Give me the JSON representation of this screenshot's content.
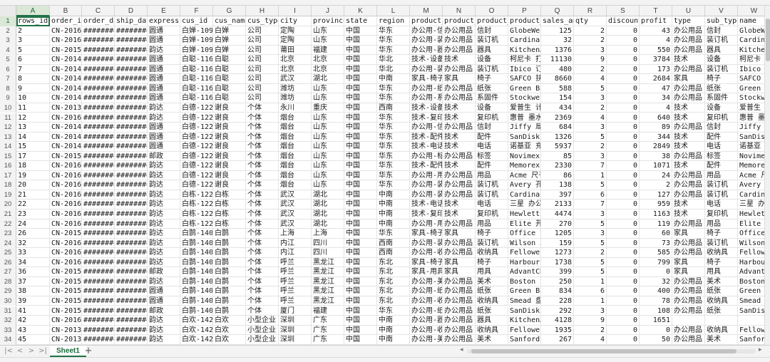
{
  "columns": [
    "A",
    "B",
    "C",
    "D",
    "E",
    "F",
    "G",
    "H",
    "I",
    "J",
    "K",
    "L",
    "M",
    "N",
    "O",
    "P",
    "Q",
    "R",
    "S",
    "T",
    "U",
    "V",
    "W"
  ],
  "selected_column": "A",
  "active_cell": "A1",
  "sheet_tab": "Sheet1",
  "add_sheet": "+",
  "nav": [
    "|<",
    "<",
    ">",
    ">|"
  ],
  "rows": [
    {
      "n": "1",
      "c": [
        "rows_id",
        "order_id",
        "order_dat",
        "ship_date",
        "express",
        "cus_id",
        "cus_name",
        "cus_type",
        "city",
        "province",
        "state",
        "region",
        "product_i",
        "product_t",
        "product_t",
        "product_n",
        "sales_amt",
        "qty",
        "discount",
        "profit",
        "type",
        "sub_type",
        "name"
      ]
    },
    {
      "n": "2",
      "c": [
        "2",
        "CN-2016-1",
        "#########",
        "#########",
        "圆通",
        "白婵-1097",
        "白婵",
        "公司",
        "定陶",
        "山东",
        "中国",
        "华东",
        "办公用-信",
        "办公用品",
        "信封",
        "GlobeWeis",
        "125",
        "2",
        "0",
        "43",
        "办公用品",
        "信封",
        "GlobeWeis"
      ]
    },
    {
      "n": "3",
      "c": [
        "3",
        "CN-2016-1",
        "#########",
        "#########",
        "圆通",
        "白婵-1097",
        "白婵",
        "公司",
        "定陶",
        "山东",
        "中国",
        "华东",
        "办公用-装",
        "办公用品",
        "装订机",
        "Cardinal",
        "32",
        "2",
        "0",
        "4",
        "办公用品",
        "装订机",
        "Cardinal"
      ]
    },
    {
      "n": "4",
      "c": [
        "5",
        "CN-2015-1",
        "#########",
        "#########",
        "韵达",
        "白婵-1097",
        "白婵",
        "公司",
        "莆田",
        "福建",
        "中国",
        "华东",
        "办公用-器",
        "办公用品",
        "器具",
        "KitchenAi",
        "1376",
        "3",
        "0",
        "550",
        "办公用品",
        "器具",
        "KitchenAi"
      ]
    },
    {
      "n": "5",
      "c": [
        "6",
        "CN-2014-4",
        "#########",
        "#########",
        "圆通",
        "白聪-1160",
        "白聪",
        "公司",
        "北京",
        "北京",
        "中国",
        "华北",
        "技术-设备",
        "技术",
        "设备",
        "柯尼卡 打",
        "11130",
        "9",
        "0",
        "3784",
        "技术",
        "设备",
        "柯尼卡 打"
      ]
    },
    {
      "n": "6",
      "c": [
        "7",
        "CN-2014-4",
        "#########",
        "#########",
        "圆通",
        "白聪-1160",
        "白聪",
        "公司",
        "北京",
        "北京",
        "中国",
        "华北",
        "办公用-装",
        "办公用品",
        "装订机",
        "Ibico 订",
        "480",
        "2",
        "0",
        "173",
        "办公用品",
        "装订机",
        "Ibico 订"
      ]
    },
    {
      "n": "7",
      "c": [
        "8",
        "CN-2014-4",
        "#########",
        "#########",
        "圆通",
        "白聪-1160",
        "白聪",
        "公司",
        "武汉",
        "湖北",
        "中国",
        "中南",
        "家具-椅子",
        "家具",
        "椅子",
        "SAFCO 扶",
        "8660",
        "4",
        "0",
        "2684",
        "家具",
        "椅子",
        "SAFCO 扶"
      ]
    },
    {
      "n": "8",
      "c": [
        "9",
        "CN-2014-4",
        "#########",
        "#########",
        "圆通",
        "白聪-1160",
        "白聪",
        "公司",
        "潍坊",
        "山东",
        "中国",
        "华东",
        "办公用-纸",
        "办公用品",
        "纸张",
        "Green Bar",
        "588",
        "5",
        "0",
        "47",
        "办公用品",
        "纸张",
        "Green Bar"
      ]
    },
    {
      "n": "9",
      "c": [
        "10",
        "CN-2014-4",
        "#########",
        "#########",
        "圆通",
        "白聪-1160",
        "白聪",
        "公司",
        "潍坊",
        "山东",
        "中国",
        "华东",
        "办公用-系",
        "办公用品",
        "系固件",
        "Stockwell",
        "154",
        "3",
        "0",
        "34",
        "办公用品",
        "系固件",
        "Stockwell"
      ]
    },
    {
      "n": "10",
      "c": [
        "11",
        "CN-2013-4",
        "#########",
        "#########",
        "韵达",
        "白德-1220",
        "谢良",
        "个体",
        "永川",
        "重庆",
        "中国",
        "西南",
        "技术-设备",
        "技术",
        "设备",
        "爱普生 计",
        "434",
        "2",
        "0",
        "4",
        "技术",
        "设备",
        "爱普生 计"
      ]
    },
    {
      "n": "11",
      "c": [
        "12",
        "CN-2016-1",
        "#########",
        "#########",
        "韵达",
        "白德-1220",
        "谢良",
        "个体",
        "烟台",
        "山东",
        "中国",
        "华东",
        "技术-复印",
        "技术",
        "复印机",
        "惠普 墨水",
        "2369",
        "4",
        "0",
        "640",
        "技术",
        "复印机",
        "惠普 墨水"
      ]
    },
    {
      "n": "12",
      "c": [
        "13",
        "CN-2014-1",
        "#########",
        "#########",
        "圆通",
        "白德-1220",
        "谢良",
        "个体",
        "烟台",
        "山东",
        "中国",
        "华东",
        "办公用-信",
        "办公用品",
        "信封",
        "Jiffy 局",
        "684",
        "3",
        "0",
        "89",
        "办公用品",
        "信封",
        "Jiffy 局"
      ]
    },
    {
      "n": "13",
      "c": [
        "14",
        "CN-2014-1",
        "#########",
        "#########",
        "圆通",
        "白德-1220",
        "谢良",
        "个体",
        "烟台",
        "山东",
        "中国",
        "华东",
        "技术-配件",
        "技术",
        "配件",
        "SanDisk 键",
        "1326",
        "5",
        "0",
        "344",
        "技术",
        "配件",
        "SanDisk 键"
      ]
    },
    {
      "n": "14",
      "c": [
        "15",
        "CN-2014-1",
        "#########",
        "#########",
        "圆通",
        "白德-1220",
        "谢良",
        "个体",
        "烟台",
        "山东",
        "中国",
        "华东",
        "技术-电话",
        "技术",
        "电话",
        "诺基亚 充",
        "5937",
        "2",
        "0",
        "2849",
        "技术",
        "电话",
        "诺基亚 充"
      ]
    },
    {
      "n": "15",
      "c": [
        "17",
        "CN-2015-1",
        "#########",
        "#########",
        "邮政",
        "白德-1220",
        "谢良",
        "个体",
        "烟台",
        "山东",
        "中国",
        "华东",
        "办公用-标",
        "办公用品",
        "标签",
        "Novimex 圆",
        "85",
        "3",
        "0",
        "38",
        "办公用品",
        "标签",
        "Novimex 圆"
      ]
    },
    {
      "n": "16",
      "c": [
        "18",
        "CN-2016-1",
        "#########",
        "#########",
        "韵达",
        "白德-1220",
        "谢良",
        "个体",
        "烟台",
        "山东",
        "中国",
        "华东",
        "技术-配件",
        "技术",
        "配件",
        "Memorex 键",
        "2330",
        "7",
        "0",
        "1071",
        "技术",
        "配件",
        "Memorex 键"
      ]
    },
    {
      "n": "17",
      "c": [
        "19",
        "CN-2016-1",
        "#########",
        "#########",
        "韵达",
        "白德-1220",
        "谢良",
        "个体",
        "烟台",
        "山东",
        "中国",
        "华东",
        "办公用-用",
        "办公用品",
        "用品",
        "Acme 尺子",
        "86",
        "1",
        "0",
        "24",
        "办公用品",
        "用品",
        "Acme 尺子"
      ]
    },
    {
      "n": "18",
      "c": [
        "20",
        "CN-2016-1",
        "#########",
        "#########",
        "韵达",
        "白德-1220",
        "谢良",
        "个体",
        "烟台",
        "山东",
        "中国",
        "华东",
        "办公用-装",
        "办公用品",
        "装订机",
        "Avery 孔加",
        "138",
        "5",
        "0",
        "2",
        "办公用品",
        "装订机",
        "Avery 孔加"
      ]
    },
    {
      "n": "19",
      "c": [
        "21",
        "CN-2016-1",
        "#########",
        "#########",
        "韵达",
        "白栋-1225",
        "白栋",
        "个体",
        "武汉",
        "湖北",
        "中国",
        "中南",
        "办公用-装",
        "办公用品",
        "装订机",
        "Cardinal",
        "397",
        "6",
        "0",
        "127",
        "办公用品",
        "装订机",
        "Cardinal"
      ]
    },
    {
      "n": "20",
      "c": [
        "22",
        "CN-2016-1",
        "#########",
        "#########",
        "韵达",
        "白栋-1225",
        "白栋",
        "个体",
        "武汉",
        "湖北",
        "中国",
        "中南",
        "技术-电话",
        "技术",
        "电话",
        "三星 办公",
        "2133",
        "7",
        "0",
        "959",
        "技术",
        "电话",
        "三星 办公"
      ]
    },
    {
      "n": "21",
      "c": [
        "23",
        "CN-2016-1",
        "#########",
        "#########",
        "韵达",
        "白栋-1225",
        "白栋",
        "个体",
        "武汉",
        "湖北",
        "中国",
        "中南",
        "技术-复印",
        "技术",
        "复印机",
        "Hewlett 复",
        "4474",
        "3",
        "0",
        "1163",
        "技术",
        "复印机",
        "Hewlett 复"
      ]
    },
    {
      "n": "22",
      "c": [
        "24",
        "CN-2016-1",
        "#########",
        "#########",
        "韵达",
        "白栋-1225",
        "白栋",
        "个体",
        "武汉",
        "湖北",
        "中国",
        "中南",
        "办公用-用",
        "办公用品",
        "用品",
        "Elite 开信",
        "270",
        "5",
        "0",
        "119",
        "办公用品",
        "用品",
        "Elite 开信"
      ]
    },
    {
      "n": "23",
      "c": [
        "26",
        "CN-2015-4",
        "#########",
        "#########",
        "韵达",
        "白鹊-1400",
        "白鹊",
        "个体",
        "上海",
        "上海",
        "中国",
        "华东",
        "家具-椅子",
        "家具",
        "椅子",
        "Office St",
        "1205",
        "3",
        "0",
        "60",
        "家具",
        "椅子",
        "Office St"
      ]
    },
    {
      "n": "24",
      "c": [
        "32",
        "CN-2016-1",
        "#########",
        "#########",
        "韵达",
        "白鹊-1400",
        "白鹊",
        "个体",
        "内江",
        "四川",
        "中国",
        "西南",
        "办公用-装",
        "办公用品",
        "装订机",
        "Wilson Jo",
        "159",
        "5",
        "0",
        "73",
        "办公用品",
        "装订机",
        "Wilson Jo"
      ]
    },
    {
      "n": "25",
      "c": [
        "33",
        "CN-2016-1",
        "#########",
        "#########",
        "韵达",
        "白鹊-1400",
        "白鹊",
        "个体",
        "内江",
        "四川",
        "中国",
        "西南",
        "办公用-收",
        "办公用品",
        "收纳具",
        "Fellowes",
        "1273",
        "2",
        "0",
        "585",
        "办公用品",
        "收纳具",
        "Fellowes"
      ]
    },
    {
      "n": "26",
      "c": [
        "34",
        "CN-2016-1",
        "#########",
        "#########",
        "韵达",
        "白鹊-1400",
        "白鹊",
        "个体",
        "呼兰",
        "黑龙江",
        "中国",
        "东北",
        "家具-椅子",
        "家具",
        "椅子",
        "Harbour 扶",
        "1738",
        "5",
        "0",
        "799",
        "家具",
        "椅子",
        "Harbour 扶"
      ]
    },
    {
      "n": "27",
      "c": [
        "36",
        "CN-2015-1",
        "#########",
        "#########",
        "邮政",
        "白鹊-1400",
        "白鹊",
        "个体",
        "呼兰",
        "黑龙江",
        "中国",
        "东北",
        "家具-用具",
        "家具",
        "用具",
        "AdvantCN",
        "399",
        "5",
        "0",
        "0",
        "家具",
        "用具",
        "AdvantCN"
      ]
    },
    {
      "n": "28",
      "c": [
        "37",
        "CN-2015-1",
        "#########",
        "#########",
        "韵达",
        "白鹊-1400",
        "白鹊",
        "个体",
        "呼兰",
        "黑龙江",
        "中国",
        "东北",
        "办公用-美",
        "办公用品",
        "美术",
        "Boston 画",
        "250",
        "1",
        "0",
        "32",
        "办公用品",
        "美术",
        "Boston 画"
      ]
    },
    {
      "n": "29",
      "c": [
        "38",
        "CN-2015-1",
        "#########",
        "#########",
        "圆通",
        "白鹊-1400",
        "白鹊",
        "个体",
        "呼兰",
        "黑龙江",
        "中国",
        "东北",
        "办公用-纸",
        "办公用品",
        "纸张",
        "Green Bar",
        "834",
        "6",
        "0",
        "400",
        "办公用品",
        "纸张",
        "Green Bar"
      ]
    },
    {
      "n": "30",
      "c": [
        "39",
        "CN-2015-1",
        "#########",
        "#########",
        "圆通",
        "白鹊-1400",
        "白鹊",
        "个体",
        "呼兰",
        "黑龙江",
        "中国",
        "东北",
        "办公用-收",
        "办公用品",
        "收纳具",
        "Smead 盘",
        "228",
        "1",
        "0",
        "78",
        "办公用品",
        "收纳具",
        "Smead 盘"
      ]
    },
    {
      "n": "31",
      "c": [
        "41",
        "CN-2015-4",
        "#########",
        "#########",
        "邮政",
        "白鹊-1400",
        "白鹊",
        "个体",
        "厦门",
        "福建",
        "中国",
        "华东",
        "办公用-纸",
        "办公用品",
        "纸张",
        "SanDisk 键",
        "292",
        "3",
        "0",
        "108",
        "办公用品",
        "纸张",
        "SanDisk 键"
      ]
    },
    {
      "n": "32",
      "c": [
        "42",
        "CN-2016-1",
        "#########",
        "#########",
        "韵达",
        "白欢-1420",
        "白欢",
        "小型企业",
        "深圳",
        "广东",
        "中国",
        "中南",
        "办公用-器",
        "办公用品",
        "器具",
        "KitchenAi",
        "4128",
        "9",
        "0",
        "1651",
        "",
        "",
        ""
      ]
    },
    {
      "n": "33",
      "c": [
        "43",
        "CN-2013-1",
        "#########",
        "#########",
        "韵达",
        "白欢-1420",
        "白欢",
        "小型企业",
        "深圳",
        "广东",
        "中国",
        "中南",
        "办公用-收",
        "办公用品",
        "收纳具",
        "Fellowes",
        "1935",
        "2",
        "0",
        "0",
        "办公用品",
        "收纳具",
        "Fellowes"
      ]
    },
    {
      "n": "34",
      "c": [
        "45",
        "CN-2013-1",
        "#########",
        "#########",
        "韵达",
        "白欢-1420",
        "白欢",
        "小型企业",
        "深圳",
        "广东",
        "中国",
        "中南",
        "办公用-美",
        "办公用品",
        "美术",
        "Sanford 木",
        "267",
        "4",
        "0",
        "50",
        "办公用品",
        "美术",
        "Sanford 木"
      ]
    }
  ]
}
